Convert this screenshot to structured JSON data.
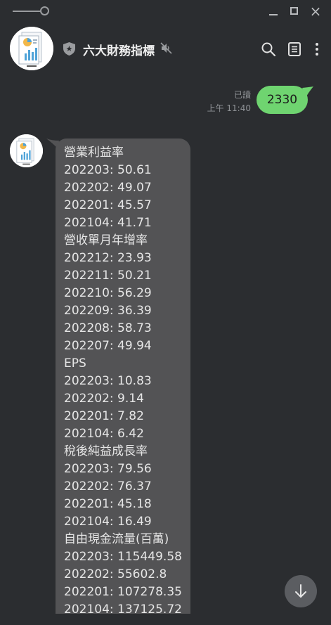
{
  "window": {
    "minimize_label": "minimize",
    "close_glyph": "×"
  },
  "header": {
    "chat_title": "六大財務指標",
    "icons": [
      "shield-icon",
      "mute-icon",
      "search-icon",
      "note-icon",
      "more-icon"
    ]
  },
  "outgoing": {
    "text": "2330",
    "read_label": "已讀",
    "time": "上午 11:40"
  },
  "incoming": {
    "lines": [
      "營業利益率",
      "202203: 50.61",
      "202202: 49.07",
      "202201: 45.57",
      "202104: 41.71",
      "營收單月年增率",
      "202212: 23.93",
      "202211: 50.21",
      "202210: 56.29",
      "202209: 36.39",
      "202208: 58.73",
      "202207: 49.94",
      "EPS",
      "202203: 10.83",
      "202202: 9.14",
      "202201: 7.82",
      "202104: 6.42",
      "稅後純益成長率",
      "202203: 79.56",
      "202202: 76.37",
      "202201: 45.18",
      "202104: 16.49",
      "自由現金流量(百萬)",
      "202203: 115449.58",
      "202202: 55602.8",
      "202201: 107278.35",
      "202104: 137125.72"
    ]
  },
  "colors": {
    "background": "#2b2d30",
    "outgoing_bubble": "#6fd470",
    "incoming_bubble": "#535355",
    "text_light": "#e6e6e6"
  }
}
